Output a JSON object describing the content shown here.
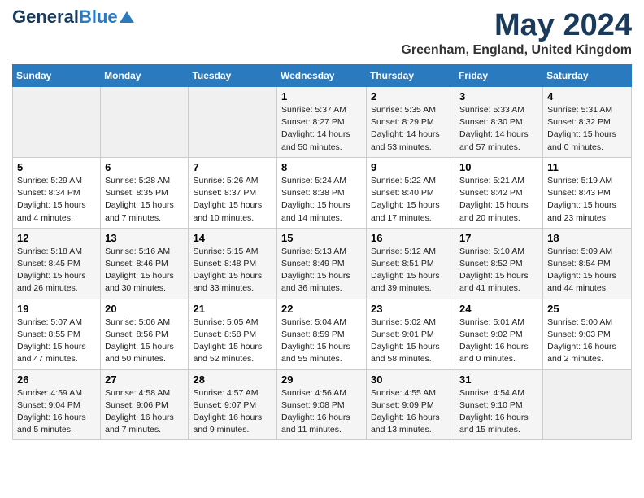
{
  "header": {
    "logo_general": "General",
    "logo_blue": "Blue",
    "month_year": "May 2024",
    "location": "Greenham, England, United Kingdom"
  },
  "weekdays": [
    "Sunday",
    "Monday",
    "Tuesday",
    "Wednesday",
    "Thursday",
    "Friday",
    "Saturday"
  ],
  "weeks": [
    [
      {
        "day": "",
        "info": ""
      },
      {
        "day": "",
        "info": ""
      },
      {
        "day": "",
        "info": ""
      },
      {
        "day": "1",
        "info": "Sunrise: 5:37 AM\nSunset: 8:27 PM\nDaylight: 14 hours\nand 50 minutes."
      },
      {
        "day": "2",
        "info": "Sunrise: 5:35 AM\nSunset: 8:29 PM\nDaylight: 14 hours\nand 53 minutes."
      },
      {
        "day": "3",
        "info": "Sunrise: 5:33 AM\nSunset: 8:30 PM\nDaylight: 14 hours\nand 57 minutes."
      },
      {
        "day": "4",
        "info": "Sunrise: 5:31 AM\nSunset: 8:32 PM\nDaylight: 15 hours\nand 0 minutes."
      }
    ],
    [
      {
        "day": "5",
        "info": "Sunrise: 5:29 AM\nSunset: 8:34 PM\nDaylight: 15 hours\nand 4 minutes."
      },
      {
        "day": "6",
        "info": "Sunrise: 5:28 AM\nSunset: 8:35 PM\nDaylight: 15 hours\nand 7 minutes."
      },
      {
        "day": "7",
        "info": "Sunrise: 5:26 AM\nSunset: 8:37 PM\nDaylight: 15 hours\nand 10 minutes."
      },
      {
        "day": "8",
        "info": "Sunrise: 5:24 AM\nSunset: 8:38 PM\nDaylight: 15 hours\nand 14 minutes."
      },
      {
        "day": "9",
        "info": "Sunrise: 5:22 AM\nSunset: 8:40 PM\nDaylight: 15 hours\nand 17 minutes."
      },
      {
        "day": "10",
        "info": "Sunrise: 5:21 AM\nSunset: 8:42 PM\nDaylight: 15 hours\nand 20 minutes."
      },
      {
        "day": "11",
        "info": "Sunrise: 5:19 AM\nSunset: 8:43 PM\nDaylight: 15 hours\nand 23 minutes."
      }
    ],
    [
      {
        "day": "12",
        "info": "Sunrise: 5:18 AM\nSunset: 8:45 PM\nDaylight: 15 hours\nand 26 minutes."
      },
      {
        "day": "13",
        "info": "Sunrise: 5:16 AM\nSunset: 8:46 PM\nDaylight: 15 hours\nand 30 minutes."
      },
      {
        "day": "14",
        "info": "Sunrise: 5:15 AM\nSunset: 8:48 PM\nDaylight: 15 hours\nand 33 minutes."
      },
      {
        "day": "15",
        "info": "Sunrise: 5:13 AM\nSunset: 8:49 PM\nDaylight: 15 hours\nand 36 minutes."
      },
      {
        "day": "16",
        "info": "Sunrise: 5:12 AM\nSunset: 8:51 PM\nDaylight: 15 hours\nand 39 minutes."
      },
      {
        "day": "17",
        "info": "Sunrise: 5:10 AM\nSunset: 8:52 PM\nDaylight: 15 hours\nand 41 minutes."
      },
      {
        "day": "18",
        "info": "Sunrise: 5:09 AM\nSunset: 8:54 PM\nDaylight: 15 hours\nand 44 minutes."
      }
    ],
    [
      {
        "day": "19",
        "info": "Sunrise: 5:07 AM\nSunset: 8:55 PM\nDaylight: 15 hours\nand 47 minutes."
      },
      {
        "day": "20",
        "info": "Sunrise: 5:06 AM\nSunset: 8:56 PM\nDaylight: 15 hours\nand 50 minutes."
      },
      {
        "day": "21",
        "info": "Sunrise: 5:05 AM\nSunset: 8:58 PM\nDaylight: 15 hours\nand 52 minutes."
      },
      {
        "day": "22",
        "info": "Sunrise: 5:04 AM\nSunset: 8:59 PM\nDaylight: 15 hours\nand 55 minutes."
      },
      {
        "day": "23",
        "info": "Sunrise: 5:02 AM\nSunset: 9:01 PM\nDaylight: 15 hours\nand 58 minutes."
      },
      {
        "day": "24",
        "info": "Sunrise: 5:01 AM\nSunset: 9:02 PM\nDaylight: 16 hours\nand 0 minutes."
      },
      {
        "day": "25",
        "info": "Sunrise: 5:00 AM\nSunset: 9:03 PM\nDaylight: 16 hours\nand 2 minutes."
      }
    ],
    [
      {
        "day": "26",
        "info": "Sunrise: 4:59 AM\nSunset: 9:04 PM\nDaylight: 16 hours\nand 5 minutes."
      },
      {
        "day": "27",
        "info": "Sunrise: 4:58 AM\nSunset: 9:06 PM\nDaylight: 16 hours\nand 7 minutes."
      },
      {
        "day": "28",
        "info": "Sunrise: 4:57 AM\nSunset: 9:07 PM\nDaylight: 16 hours\nand 9 minutes."
      },
      {
        "day": "29",
        "info": "Sunrise: 4:56 AM\nSunset: 9:08 PM\nDaylight: 16 hours\nand 11 minutes."
      },
      {
        "day": "30",
        "info": "Sunrise: 4:55 AM\nSunset: 9:09 PM\nDaylight: 16 hours\nand 13 minutes."
      },
      {
        "day": "31",
        "info": "Sunrise: 4:54 AM\nSunset: 9:10 PM\nDaylight: 16 hours\nand 15 minutes."
      },
      {
        "day": "",
        "info": ""
      }
    ]
  ]
}
